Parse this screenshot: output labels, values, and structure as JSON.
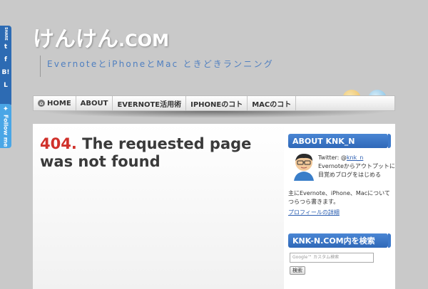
{
  "share": {
    "share_label": "SHARE",
    "twitter_glyph": "t",
    "facebook_glyph": "f",
    "hatena_label": "B!",
    "livedoor_glyph": "L",
    "follow_label": "Follow me"
  },
  "header": {
    "title_main": "けんけん",
    "title_domain": ".COM",
    "tagline": "EvernoteとiPhoneとMac ときどきランニング"
  },
  "nav": {
    "items": [
      {
        "label": "HOME"
      },
      {
        "label": "ABOUT"
      },
      {
        "label": "EVERNOTE活用術"
      },
      {
        "label": "IPHONEのコト"
      },
      {
        "label": "MACのコト"
      }
    ]
  },
  "main": {
    "error_code": "404.",
    "error_message": " The requested page was not found"
  },
  "sidebar": {
    "about_title": "ABOUT KNK_N",
    "twitter_prefix": "Twitter: @",
    "twitter_handle": "knk_n",
    "bio_short": "Evernoteからアウトプットに目覚めブログをはじめる",
    "bio_long": "主にEvernote、iPhone、Macについてつらつら書きます。",
    "profile_link": "プロフィールの詳細",
    "search_title": "KNK-N.COM内を検索",
    "search_placeholder": "Google™ カスタム検索",
    "search_button": "検索"
  },
  "colors": {
    "background": "#c9c9c9",
    "accent_blue": "#2f68b8",
    "error_red": "#d0312b",
    "link": "#2a5db0"
  }
}
